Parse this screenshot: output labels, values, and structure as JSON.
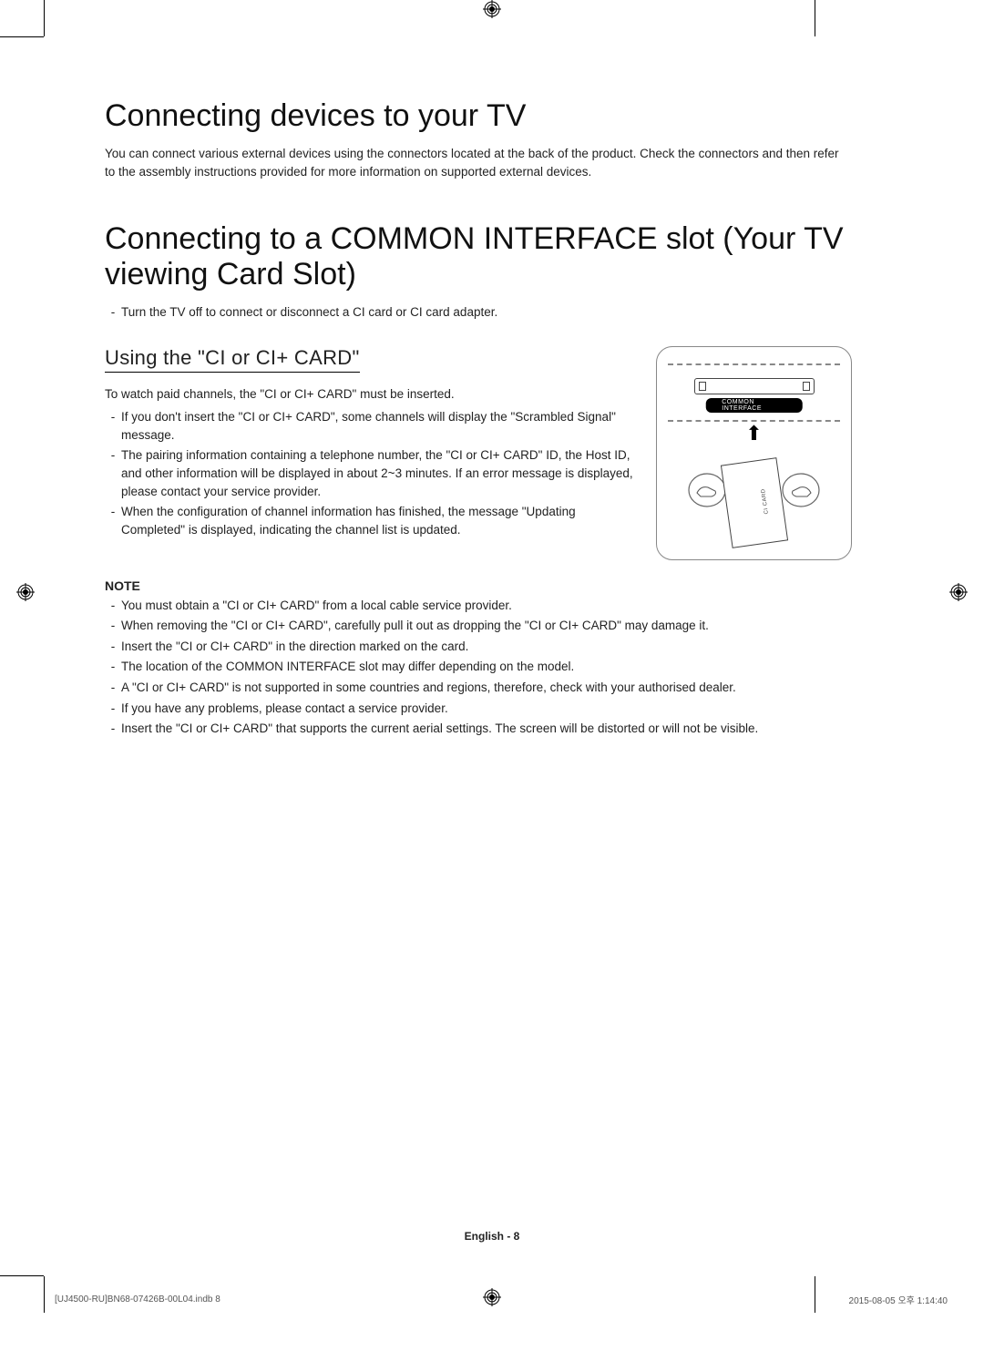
{
  "headings": {
    "h1a": "Connecting devices to your TV",
    "intro": "You can connect various external devices using the connectors located at the back of the product. Check the connectors and then refer to the assembly instructions provided for more information on supported external devices.",
    "h1b": "Connecting to a COMMON INTERFACE slot (Your TV viewing Card Slot)",
    "b1": "Turn the TV off to connect or disconnect a CI card or CI card adapter.",
    "h2": "Using the \"CI or CI+ CARD\"",
    "p1": "To watch paid channels, the \"CI or CI+ CARD\" must be inserted.",
    "li1": "If you don't insert the \"CI or CI+ CARD\", some channels will display the \"Scrambled Signal\" message.",
    "li2": "The pairing information containing a telephone number, the \"CI or CI+ CARD\" ID, the Host ID, and other information will be displayed in about 2~3 minutes. If an error message is displayed, please contact your service provider.",
    "li3": "When the configuration of channel information has finished, the message \"Updating Completed\" is displayed, indicating the channel list is updated."
  },
  "note": {
    "hdr": "NOTE",
    "n1": "You must obtain a \"CI or CI+ CARD\" from a local cable service provider.",
    "n2": "When removing the \"CI or CI+ CARD\", carefully pull it out as dropping the \"CI or CI+ CARD\" may damage it.",
    "n3": "Insert the \"CI or CI+ CARD\" in the direction marked on the card.",
    "n4": "The location of the COMMON INTERFACE slot may differ depending on the model.",
    "n5": "A \"CI or CI+ CARD\" is not supported in some countries and regions, therefore, check with your authorised dealer.",
    "n6": "If you have any problems, please contact a service provider.",
    "n7": "Insert the \"CI or CI+ CARD\" that supports the current aerial settings. The screen will be distorted or will not be visible."
  },
  "figure": {
    "slot_label": "COMMON INTERFACE",
    "card_label": "CI CARD"
  },
  "footer": {
    "lang_page": "English - 8",
    "file": "[UJ4500-RU]BN68-07426B-00L04.indb   8",
    "timestamp": "2015-08-05   오후 1:14:40"
  }
}
